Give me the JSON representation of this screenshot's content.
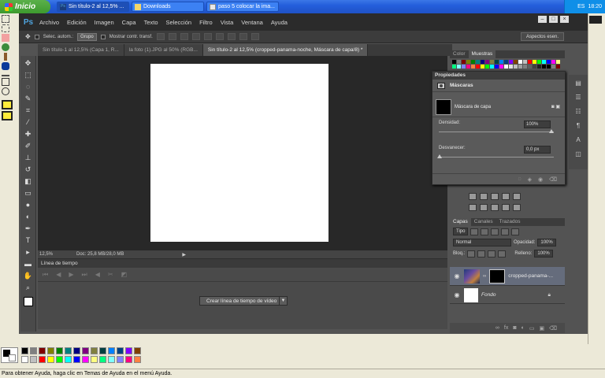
{
  "taskbar": {
    "start_label": "Inicio",
    "buttons": [
      {
        "label": "Sin título-2 al 12,5% ...",
        "active": true
      },
      {
        "label": "Downloads",
        "active": false
      },
      {
        "label": "paso 5 colocar la ima...",
        "active": false
      }
    ],
    "lang": "ES",
    "clock": "18:20"
  },
  "photoshop": {
    "logo": "Ps",
    "menu": [
      "Archivo",
      "Edición",
      "Imagen",
      "Capa",
      "Texto",
      "Selección",
      "Filtro",
      "Vista",
      "Ventana",
      "Ayuda"
    ],
    "options": {
      "auto_select": "Selec. autom.:",
      "group": "Grupo",
      "show_transform": "Mostrar contr. transf.",
      "workspace": "Aspectos esen."
    },
    "tabs": [
      "Sin título-1 al 12,5% (Capa 1, R...",
      "la foto (1).JPG al 50% (RGB...",
      "Sin título-2 al 12,5% (cropped-panama-noche, Máscara de capa/8) *"
    ],
    "status": {
      "zoom": "12,5%",
      "doc": "Doc: 25,8 MB/28,0 MB"
    },
    "timeline": {
      "title": "Línea de tiempo",
      "create_button": "Crear línea de tiempo de vídeo"
    },
    "color_panel": {
      "tabs": [
        "Color",
        "Muestras"
      ]
    },
    "properties": {
      "header": "Propiedades",
      "title": "Máscaras",
      "mask_label": "Máscara de capa",
      "density_label": "Densidad:",
      "density_value": "100%",
      "feather_label": "Desvanecer:",
      "feather_value": "0,0 px"
    },
    "layers": {
      "tabs": [
        "Capas",
        "Canales",
        "Trazados"
      ],
      "kind": "Tipo",
      "blend_mode": "Normal",
      "opacity_label": "Opacidad:",
      "opacity_value": "100%",
      "lock_label": "Bloq.:",
      "fill_label": "Relleno:",
      "fill_value": "100%",
      "items": [
        {
          "name": "cropped-panama-...",
          "selected": true
        },
        {
          "name": "Fondo",
          "selected": false
        }
      ]
    }
  },
  "paint": {
    "status_text": "Para obtener Ayuda, haga clic en Temas de Ayuda en el menú Ayuda."
  },
  "colors": {
    "palette": [
      "#000000",
      "#808080",
      "#800000",
      "#808000",
      "#008000",
      "#008080",
      "#000080",
      "#800080",
      "#808040",
      "#004040",
      "#0080ff",
      "#004080",
      "#8000ff",
      "#804000",
      "#ffffff",
      "#c0c0c0",
      "#ff0000",
      "#ffff00",
      "#00ff00",
      "#00ffff",
      "#0000ff",
      "#ff00ff",
      "#ffff80",
      "#00ff80",
      "#80ffff",
      "#8080ff",
      "#ff0080",
      "#ff8040"
    ]
  }
}
